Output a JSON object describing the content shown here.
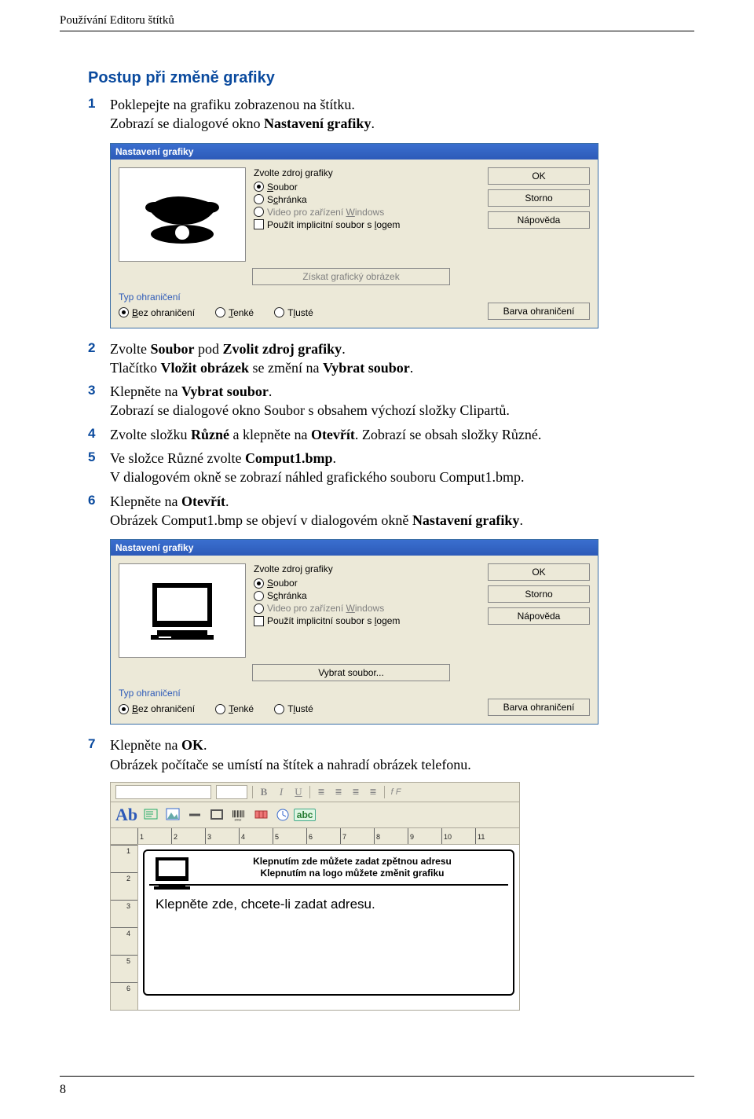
{
  "header": "Používání Editoru štítků",
  "page_number": "8",
  "section_title": "Postup při změně grafiky",
  "steps": [
    {
      "num": "1",
      "lines": [
        "Poklepejte na grafiku zobrazenou na štítku.",
        "Zobrazí se dialogové okno Nastavení grafiky."
      ]
    },
    {
      "num": "2",
      "lines": [
        "Zvolte Soubor pod Zvolit zdroj grafiky.",
        "Tlačítko Vložit obrázek se změní na Vybrat soubor."
      ]
    },
    {
      "num": "3",
      "lines": [
        "Klepněte na Vybrat soubor.",
        "Zobrazí se dialogové okno Soubor s obsahem výchozí složky Clipartů."
      ]
    },
    {
      "num": "4",
      "lines": [
        "Zvolte složku Různé a klepněte na Otevřít. Zobrazí se obsah složky Různé."
      ]
    },
    {
      "num": "5",
      "lines": [
        "Ve složce Různé zvolte Comput1.bmp.",
        "V dialogovém okně se zobrazí náhled grafického souboru Comput1.bmp."
      ]
    },
    {
      "num": "6",
      "lines": [
        "Klepněte na Otevřít.",
        "Obrázek Comput1.bmp se objeví v dialogovém okně Nastavení grafiky."
      ]
    },
    {
      "num": "7",
      "lines": [
        " Klepněte na OK.",
        "Obrázek počítače se umístí na štítek a nahradí obrázek telefonu."
      ]
    }
  ],
  "dialog_shared": {
    "title": "Nastavení grafiky",
    "source_title": "Zvolte zdroj grafiky",
    "radio_soubor": "Soubor",
    "radio_schranka": "Schránka",
    "radio_video": "Video pro zařízení Windows",
    "chk_logo": "Použít implicitní soubor s logem",
    "border_title": "Typ ohraničení",
    "border_none": "Bez ohraničení",
    "border_thin": "Tenké",
    "border_thick": "Tlusté",
    "btn_ok": "OK",
    "btn_cancel": "Storno",
    "btn_help": "Nápověda",
    "btn_border_color": "Barva ohraničení"
  },
  "dialog1": {
    "get_image": "Získat grafický obrázek"
  },
  "dialog2": {
    "vybrat_soubor": "Vybrat soubor..."
  },
  "editor": {
    "barcode_digits": "10012",
    "abc_icon": "abc",
    "ruler_h": [
      "1",
      "2",
      "3",
      "4",
      "5",
      "6",
      "7",
      "8",
      "9",
      "10",
      "11"
    ],
    "ruler_v": [
      "1",
      "2",
      "3",
      "4",
      "5",
      "6"
    ],
    "label_line1": "Klepnutím zde můžete zadat zpětnou adresu",
    "label_line2": "Klepnutím na logo můžete změnit grafiku",
    "address_text": "Klepněte zde, chcete-li zadat adresu.",
    "btn_B": "B",
    "btn_I": "I",
    "btn_U": "U",
    "btn_fF": "f F"
  },
  "bold_terms": {
    "nastaveni_grafiky": "Nastavení grafiky",
    "soubor": "Soubor",
    "zvolit_zdroj": "Zvolit zdroj grafiky",
    "vlozit_obrazek": "Vložit obrázek",
    "vybrat_soubor": "Vybrat soubor",
    "ruzne": "Různé",
    "otevrit": "Otevřít",
    "comput1": "Comput1.bmp",
    "ok": "OK"
  }
}
